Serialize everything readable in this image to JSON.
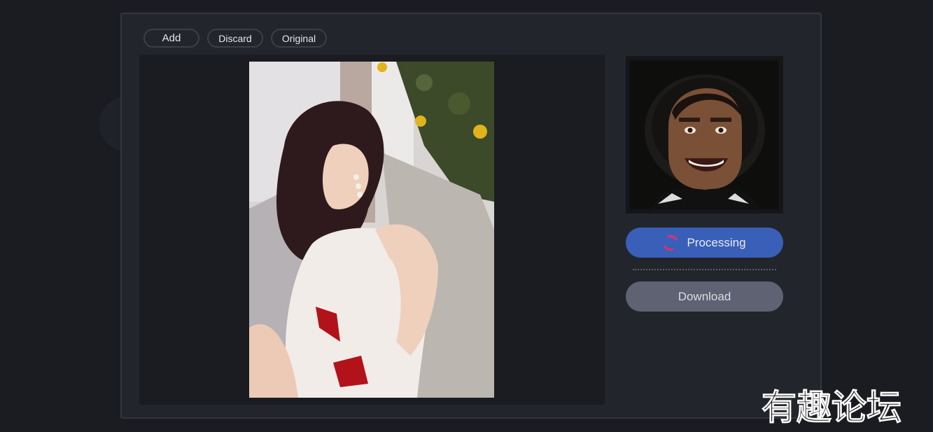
{
  "toolbar": {
    "add_label": "Add",
    "discard_label": "Discard",
    "original_label": "Original"
  },
  "images": {
    "main_photo": "target-photo",
    "face_photo": "source-face-photo"
  },
  "actions": {
    "processing_label": "Processing",
    "download_label": "Download"
  },
  "watermark": {
    "text": "有趣论坛"
  },
  "colors": {
    "background": "#1b1c21",
    "panel": "#23252d",
    "processing_button": "#3a5fb8",
    "download_button": "#5e6272",
    "spinner": "#e1306c"
  }
}
